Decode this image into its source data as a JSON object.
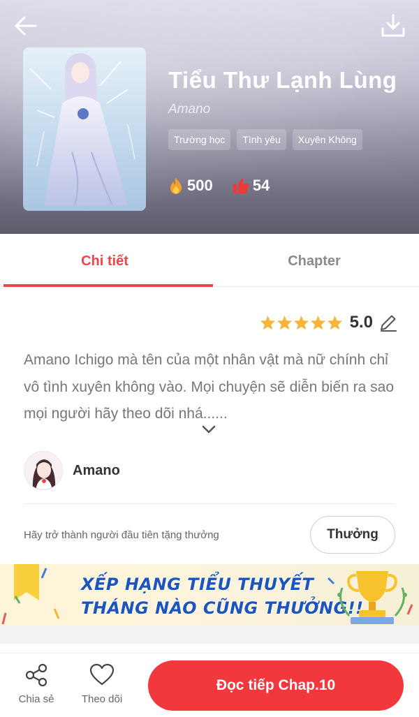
{
  "colors": {
    "accent": "#ee4549",
    "read_button": "#f2383c",
    "star": "#f7b53b",
    "banner_text": "#1e55b8"
  },
  "header": {
    "back_icon": "arrow-left-icon",
    "download_icon": "download-icon"
  },
  "novel": {
    "title": "Tiểu Thư Lạnh Lùng",
    "author": "Amano",
    "tags": [
      "Trường học",
      "Tình yêu",
      "Xuyên Không"
    ],
    "views": "500",
    "likes": "54",
    "views_icon": "fire-icon",
    "likes_icon": "thumbs-up-icon"
  },
  "tabs": [
    {
      "label": "Chi tiết",
      "active": true
    },
    {
      "label": "Chapter",
      "active": false
    }
  ],
  "rating": {
    "value": "5.0",
    "stars": 5,
    "edit_icon": "pencil-icon"
  },
  "description": {
    "text": "Amano Ichigo mà tên của một nhân vật mà nữ chính chỉ vô tình xuyên không vào. Mọi chuyện sẽ diễn biến ra sao mọi người hãy theo dõi nhá......",
    "expand_icon": "chevron-down-icon"
  },
  "author_row": {
    "name": "Amano"
  },
  "reward": {
    "text": "Hãy trở thành người đầu tiên tặng thưởng",
    "button_label": "Thưởng"
  },
  "banner": {
    "line1": "XẾP HẠNG TIỂU THUYẾT",
    "line2": "THÁNG NÀO CŨNG THƯỞNG!!",
    "trophy_icon": "trophy-icon"
  },
  "bottom_bar": {
    "share_label": "Chia sẻ",
    "follow_label": "Theo dõi",
    "read_label": "Đọc tiếp Chap.10"
  }
}
